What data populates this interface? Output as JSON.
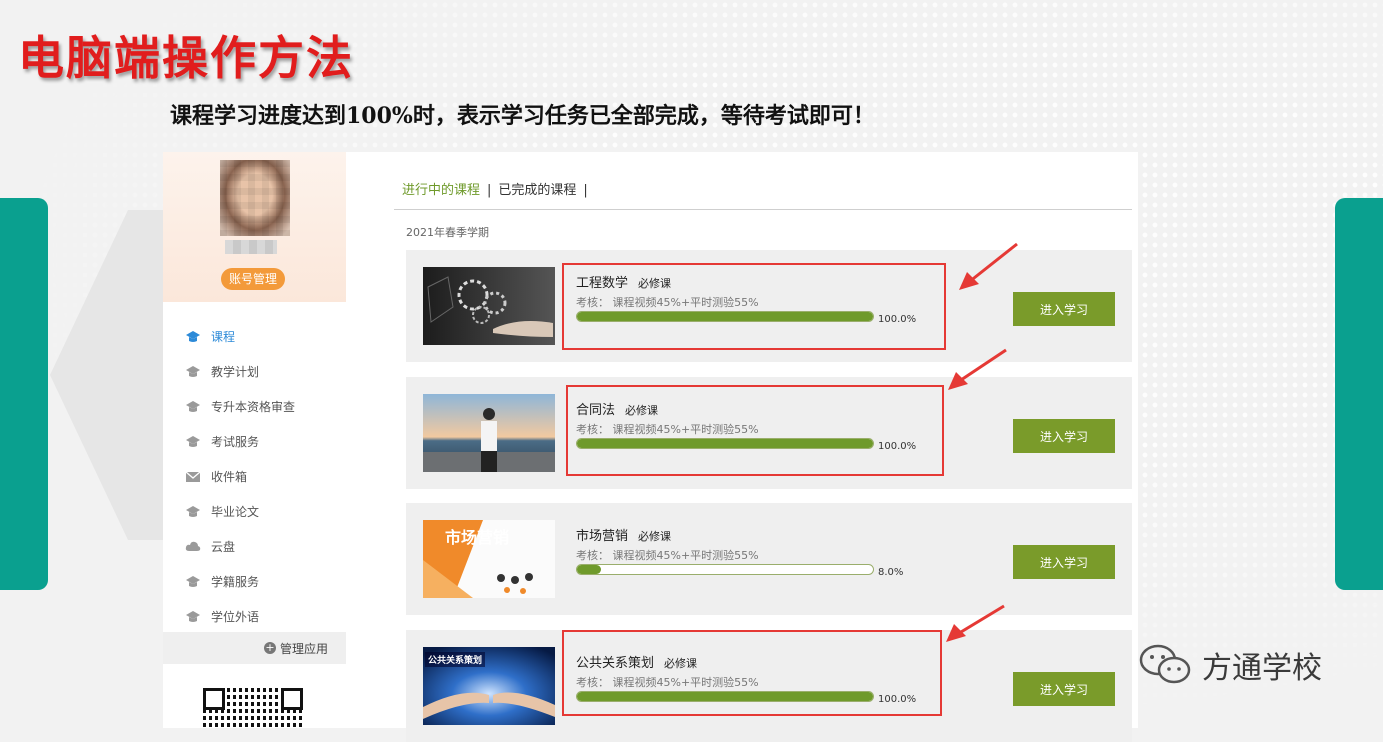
{
  "slide": {
    "title": "电脑端操作方法",
    "subtitle": "课程学习进度达到100%时，表示学习任务已全部完成，等待考试即可！"
  },
  "sidebar": {
    "account_button": "账号管理",
    "items": [
      {
        "label": "课程",
        "icon": "graduation-cap-icon",
        "active": true
      },
      {
        "label": "教学计划",
        "icon": "graduation-cap-icon"
      },
      {
        "label": "专升本资格审查",
        "icon": "graduation-cap-icon"
      },
      {
        "label": "考试服务",
        "icon": "graduation-cap-icon"
      },
      {
        "label": "收件箱",
        "icon": "inbox-icon"
      },
      {
        "label": "毕业论文",
        "icon": "graduation-cap-icon"
      },
      {
        "label": "云盘",
        "icon": "cloud-icon"
      },
      {
        "label": "学籍服务",
        "icon": "graduation-cap-icon"
      },
      {
        "label": "学位外语",
        "icon": "graduation-cap-icon"
      }
    ],
    "manage_apps": "管理应用"
  },
  "main": {
    "tabs": [
      {
        "label": "进行中的课程",
        "active": true
      },
      {
        "label": "已完成的课程"
      }
    ],
    "term": "2021年春季学期",
    "courses": [
      {
        "name": "工程数学",
        "tag": "必修课",
        "assess": "考核： 课程视频45%+平时测验55%",
        "progress": 1.0,
        "progress_text": "100.0%",
        "button": "进入学习"
      },
      {
        "name": "合同法",
        "tag": "必修课",
        "assess": "考核： 课程视频45%+平时测验55%",
        "progress": 1.0,
        "progress_text": "100.0%",
        "button": "进入学习"
      },
      {
        "name": "市场营销",
        "tag": "必修课",
        "assess": "考核： 课程视频45%+平时测验55%",
        "progress": 0.08,
        "progress_text": "8.0%",
        "button": "进入学习"
      },
      {
        "name": "公共关系策划",
        "tag": "必修课",
        "assess": "考核： 课程视频45%+平时测验55%",
        "progress": 1.0,
        "progress_text": "100.0%",
        "button": "进入学习"
      }
    ]
  },
  "thumbs": {
    "marketing_title": "市场营销",
    "pr_title": "公共关系策划"
  },
  "watermark": "方通学校",
  "colors": {
    "title_red": "#e11d1d",
    "accent_green": "#7a9b2a",
    "teal": "#0aa08f",
    "highlight_red": "#e53935"
  }
}
